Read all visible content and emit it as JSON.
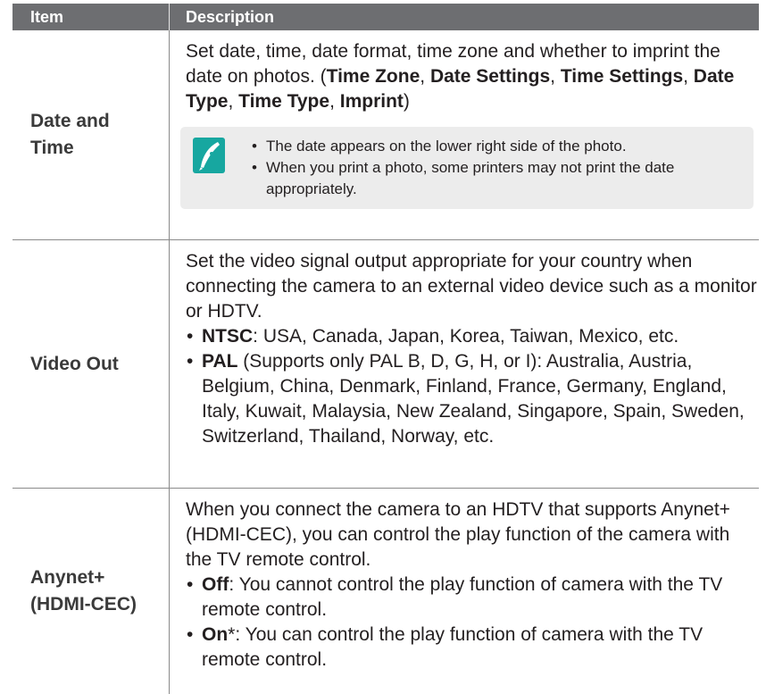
{
  "header": {
    "item": "Item",
    "description": "Description"
  },
  "rows": [
    {
      "item_lines": [
        "Date and",
        "Time"
      ],
      "intro": "Set date, time, date format, time zone and whether to imprint the date on photos. (",
      "options": [
        {
          "label": "Time Zone",
          "sep": ", "
        },
        {
          "label": "Date Settings",
          "sep": ", "
        },
        {
          "label": "Time Settings",
          "sep": ", "
        },
        {
          "label": "Date Type",
          "sep": ", "
        },
        {
          "label": "Time Type",
          "sep": ", "
        },
        {
          "label": "Imprint",
          "sep": ")"
        }
      ],
      "note": {
        "icon": "pen-note-icon",
        "bullets": [
          "The date appears on the lower right side of the photo.",
          "When you print a photo, some printers may not print the date appropriately."
        ]
      }
    },
    {
      "item": "Video Out",
      "intro": "Set the video signal output appropriate for your country when connecting the camera to an external video device such as a monitor or HDTV.",
      "bullets": [
        {
          "bold": "NTSC",
          "text": ": USA, Canada, Japan, Korea, Taiwan, Mexico, etc."
        },
        {
          "bold": "PAL",
          "text": " (Supports only PAL B, D, G, H, or I): Australia, Austria, Belgium, China, Denmark, Finland, France, Germany, England, Italy, Kuwait, Malaysia, New Zealand, Singapore, Spain, Sweden, Switzerland, Thailand, Norway, etc."
        }
      ]
    },
    {
      "item_lines": [
        "Anynet+",
        "(HDMI-CEC)"
      ],
      "intro": "When you connect the camera to an HDTV that supports Anynet+ (HDMI-CEC), you can control the play function of the camera with the TV remote control.",
      "bullets": [
        {
          "bold": "Off",
          "text": ": You cannot control the play function of camera with the TV remote control."
        },
        {
          "bold": "On",
          "text": "*: You can control the play function of camera with the TV remote control."
        }
      ]
    }
  ],
  "bullet_char": "•",
  "colors": {
    "header_bg": "#6d6e71",
    "note_bg": "#ececec",
    "note_icon": "#17a7a0"
  }
}
